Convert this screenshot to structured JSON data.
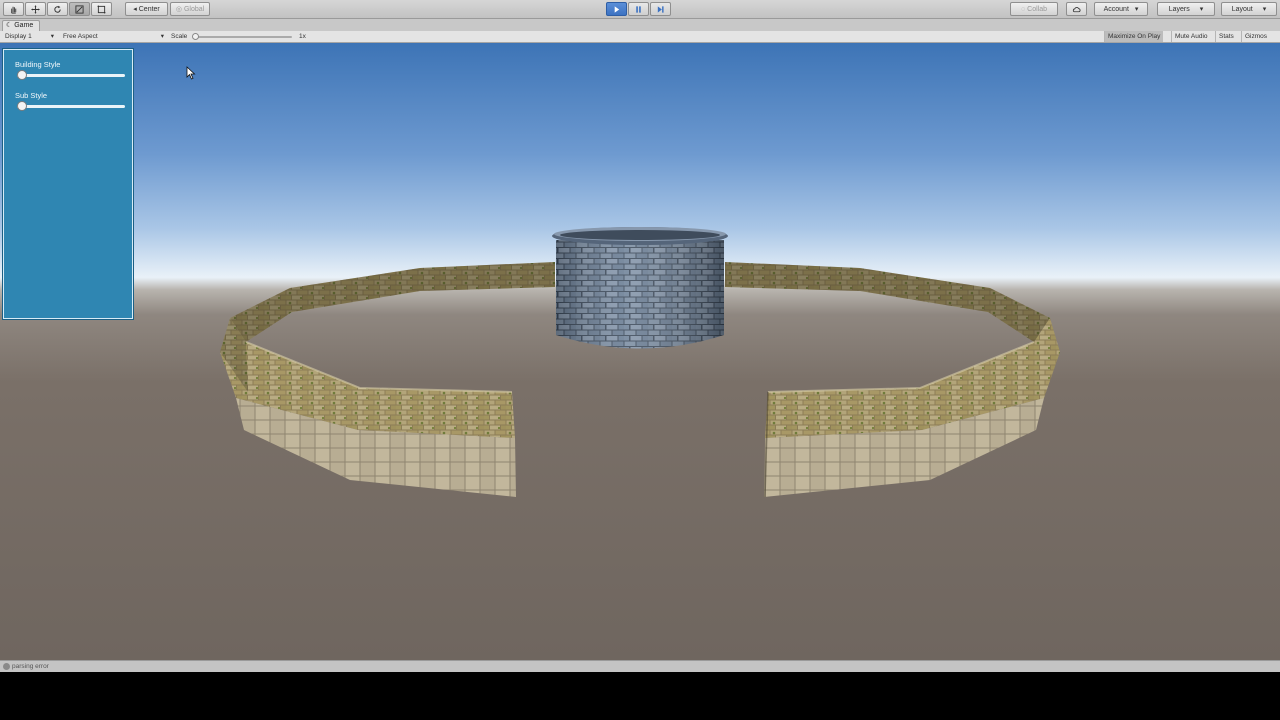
{
  "toolbar": {
    "tools": [
      "hand-tool",
      "move-tool",
      "rotate-tool",
      "scale-tool",
      "rect-tool"
    ],
    "pivot_label": "Center",
    "space_label": "Global",
    "collab_label": "Collab",
    "account_label": "Account",
    "layers_label": "Layers",
    "layout_label": "Layout"
  },
  "game_tab": {
    "title": "Game"
  },
  "game_bar": {
    "display": "Display 1",
    "aspect": "Free Aspect",
    "scale_label": "Scale",
    "scale_value": "1x",
    "maximize_on_play": "Maximize On Play",
    "mute_audio": "Mute Audio",
    "stats": "Stats",
    "gizmos": "Gizmos"
  },
  "panel": {
    "sliders": [
      {
        "label": "Building Style",
        "value": 0.0
      },
      {
        "label": "Sub Style",
        "value": 0.0
      }
    ]
  },
  "status": {
    "text": "parsing error"
  },
  "colors": {
    "panel_bg": "#2f86b2",
    "play_active": "#3c72c2",
    "ground": "#6f665f",
    "sky_top": "#3d74b6"
  }
}
